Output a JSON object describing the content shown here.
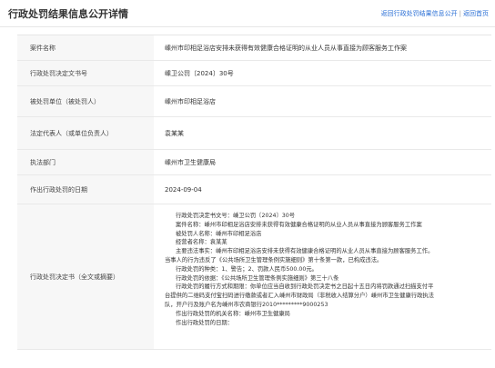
{
  "page": {
    "title": "行政处罚结果信息公开详情",
    "nav": [
      "返回行政处罚结果信息公开",
      "返回首页"
    ]
  },
  "rows": [
    {
      "label": "案件名称",
      "value": "嵊州市印相足浴店安排未获得有效健康合格证明的从业人员从事直接为顾客服务工作案"
    },
    {
      "label": "行政处罚决定文书号",
      "value": "嵊卫公罚〔2024〕30号"
    },
    {
      "label": "被处罚单位（被处罚人）",
      "value": "嵊州市印相足浴店"
    },
    {
      "label": "法定代表人（或单位负责人）",
      "value": "袁某某"
    },
    {
      "label": "执法部门",
      "value": "嵊州市卫生健康局"
    },
    {
      "label": "作出行政处罚的日期",
      "value": "2024-09-04"
    },
    {
      "label": "行政处罚决定书（全文或摘要）"
    }
  ],
  "decision_lines": [
    {
      "text": "行政处罚决定书文号：嵊卫公罚〔2024〕30号",
      "indent": true
    },
    {
      "text": "案件名称：嵊州市印相足浴店安排未获得有效健康合格证明的从业人员从事直接为顾客服务工作案",
      "indent": true
    },
    {
      "text": "被处罚人名称：嵊州市印相足浴店",
      "indent": true
    },
    {
      "text": "经营者名称：袁某某",
      "indent": true
    },
    {
      "text": "主要违法事实：嵊州市印相足浴店安排未获得有效健康合格证明的从业人员从事直接为顾客服务工作。",
      "indent": true
    },
    {
      "text": "当事人的行为违反了《公共场所卫生管理条例实施细则》第十条第一款，已构成违法。",
      "indent": false
    },
    {
      "text": "行政处罚的种类：1、警告；2、罚款人民币500.00元。",
      "indent": true
    },
    {
      "text": "行政处罚的依据：《公共场所卫生管理条例实施细则》第三十八条",
      "indent": true
    },
    {
      "text": "行政处罚的履行方式和期限：你单位应当自收到行政处罚决定书之日起十五日内将罚款通过扫描支付平",
      "indent": true
    },
    {
      "text": "台提供的二维码支付宝扫码进行缴款或者汇入嵊州市财政局（非税收入结算分户）嵊州市卫生健康行政执法",
      "indent": false
    },
    {
      "text": "队，开户行及账户名为嵊州市农商银行2010*********9000253",
      "indent": false
    },
    {
      "text": "作出行政处罚的机关名称：嵊州市卫生健康局",
      "indent": true
    },
    {
      "text": "作出行政处罚的日期：",
      "indent": true
    }
  ]
}
